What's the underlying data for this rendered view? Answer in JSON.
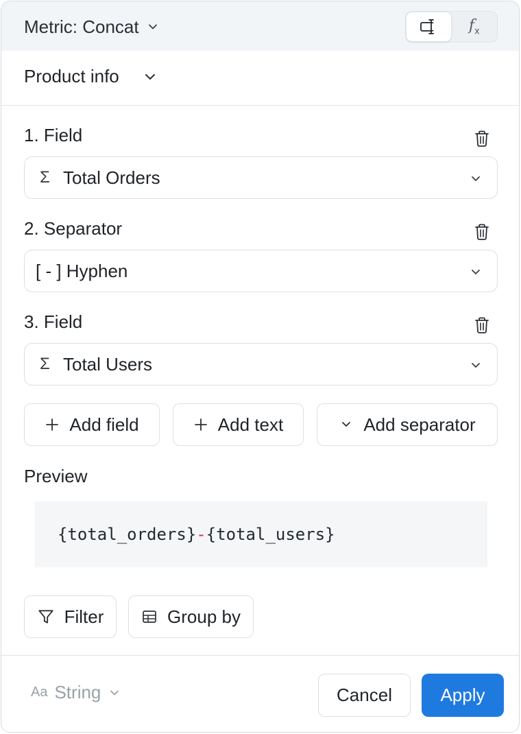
{
  "header": {
    "metric_label": "Metric: Concat",
    "mode_toggle": {
      "active": "visual",
      "options": [
        {
          "name": "visual-editor",
          "icon": "text-cursor-box-icon"
        },
        {
          "name": "formula",
          "icon": "fx-icon",
          "text": "f",
          "sub": "x"
        }
      ]
    }
  },
  "group": {
    "label": "Product info"
  },
  "items": [
    {
      "label": "1. Field",
      "icon": "sigma-icon",
      "icon_glyph": "Σ",
      "value": "Total Orders"
    },
    {
      "label": "2. Separator",
      "icon": "",
      "icon_glyph": "",
      "value": "[ - ] Hyphen"
    },
    {
      "label": "3. Field",
      "icon": "sigma-icon",
      "icon_glyph": "Σ",
      "value": "Total Users"
    }
  ],
  "actions": {
    "add_field": "Add field",
    "add_text": "Add text",
    "add_separator": "Add separator"
  },
  "preview": {
    "label": "Preview",
    "part1": "{total_orders}",
    "separator": "-",
    "part2": "{total_users}"
  },
  "tools": {
    "filter": "Filter",
    "group_by": "Group by"
  },
  "footer": {
    "type_icon": "Aa",
    "type_label": "String",
    "cancel": "Cancel",
    "apply": "Apply"
  },
  "colors": {
    "accent": "#1f7ae0",
    "separator_highlight": "#d0343a",
    "header_bg": "#f2f5f8"
  }
}
